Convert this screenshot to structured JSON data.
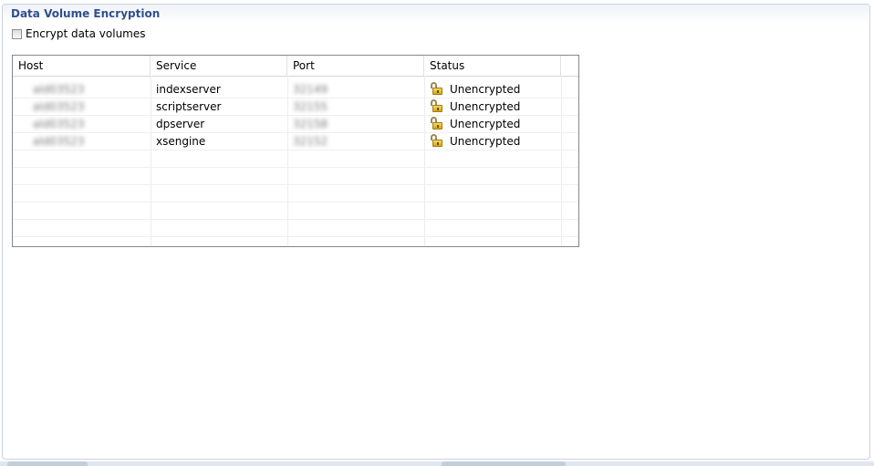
{
  "section": {
    "title": "Data Volume Encryption"
  },
  "encrypt_checkbox": {
    "label": "Encrypt data volumes",
    "checked": false
  },
  "table": {
    "columns": [
      "Host",
      "Service",
      "Port",
      "Status"
    ],
    "rows": [
      {
        "host": "ald03523",
        "service": "indexserver",
        "port": "32149",
        "status": "Unencrypted",
        "status_icon": "unlocked-padlock-icon"
      },
      {
        "host": "ald03523",
        "service": "scriptserver",
        "port": "32155",
        "status": "Unencrypted",
        "status_icon": "unlocked-padlock-icon"
      },
      {
        "host": "ald03523",
        "service": "dpserver",
        "port": "32158",
        "status": "Unencrypted",
        "status_icon": "unlocked-padlock-icon"
      },
      {
        "host": "ald03523",
        "service": "xsengine",
        "port": "32152",
        "status": "Unencrypted",
        "status_icon": "unlocked-padlock-icon"
      }
    ]
  },
  "colors": {
    "title": "#2f4f8c",
    "lock": "#e6bf33"
  }
}
